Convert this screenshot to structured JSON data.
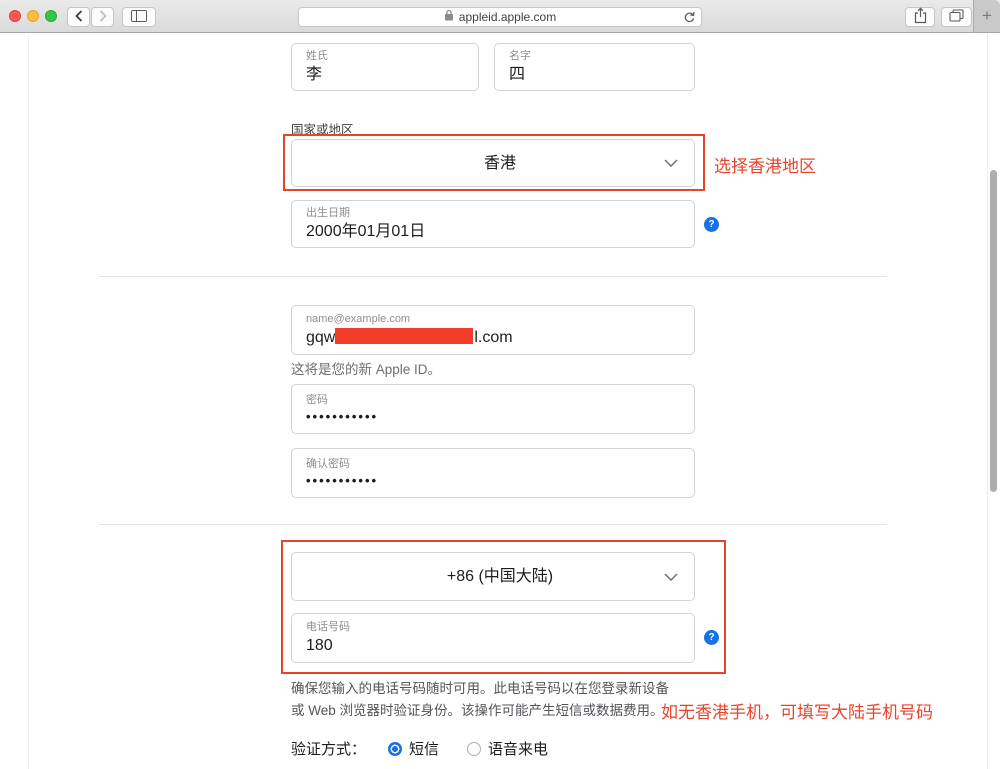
{
  "browser": {
    "url_host": "appleid.apple.com",
    "new_tab_label": "+"
  },
  "form": {
    "last_name": {
      "label": "姓氏",
      "value": "李"
    },
    "first_name": {
      "label": "名字",
      "value": "四"
    },
    "country_section_label": "国家或地区",
    "country_select": {
      "value": "香港"
    },
    "birthday": {
      "label": "出生日期",
      "value": "2000年01月01日"
    },
    "email": {
      "placeholder_label": "name@example.com",
      "value_prefix": "gqw",
      "value_suffix": "l.com"
    },
    "email_note": "这将是您的新 Apple ID。",
    "password": {
      "label": "密码",
      "masked_value": "•••••••••••"
    },
    "confirm_password": {
      "label": "确认密码",
      "masked_value": "•••••••••••"
    },
    "dial_code_select": {
      "value": "+86 (中国大陆)"
    },
    "phone": {
      "label": "电话号码",
      "value": "180"
    },
    "phone_note_line1": "确保您输入的电话号码随时可用。此电话号码以在您登录新设备",
    "phone_note_line2": "或 Web 浏览器时验证身份。该操作可能产生短信或数据费用。",
    "verification": {
      "label": "验证方式：",
      "options": [
        {
          "label": "短信",
          "selected": true
        },
        {
          "label": "语音来电",
          "selected": false
        }
      ]
    }
  },
  "annotations": {
    "country_tip": "选择香港地区",
    "phone_tip": "如无香港手机，可填写大陆手机号码"
  },
  "icons": {
    "help_glyph": "?"
  },
  "colors": {
    "annotation_red": "#e8432d",
    "accent_blue": "#1673e1"
  }
}
